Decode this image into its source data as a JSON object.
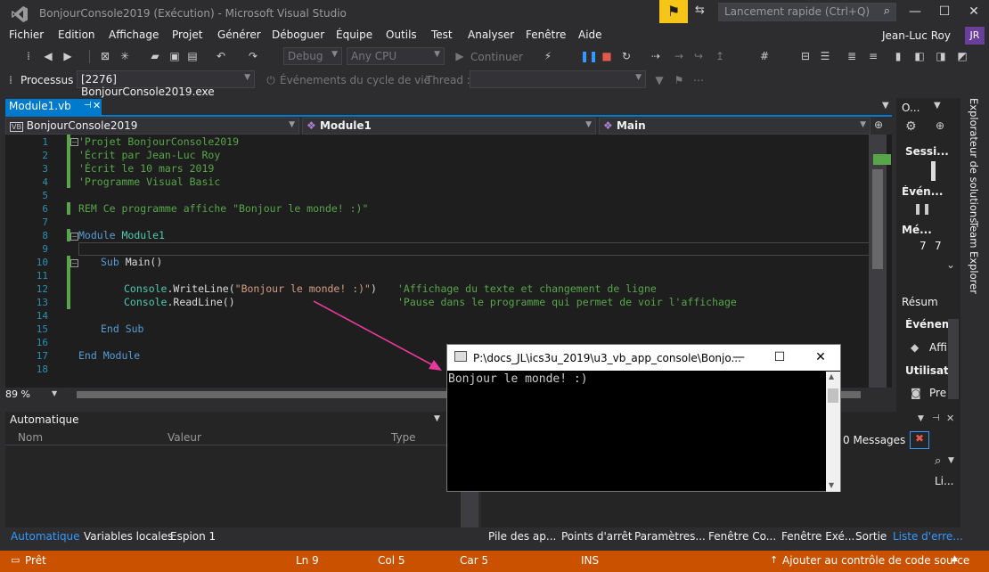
{
  "window": {
    "title": "BonjourConsole2019 (Exécution) - Microsoft Visual Studio",
    "quick_launch_placeholder": "Lancement rapide (Ctrl+Q)",
    "user": "Jean-Luc Roy",
    "user_initials": "JR"
  },
  "menu": [
    "Fichier",
    "Edition",
    "Affichage",
    "Projet",
    "Générer",
    "Déboguer",
    "Équipe",
    "Outils",
    "Test",
    "Analyser",
    "Fenêtre",
    "Aide"
  ],
  "toolbar": {
    "config": "Debug",
    "platform": "Any CPU",
    "continue": "Continuer"
  },
  "debug_toolbar": {
    "process_label": "Processus :",
    "process_value": "[2276] BonjourConsole2019.exe",
    "lifecycle": "Événements du cycle de vie",
    "thread": "Thread :"
  },
  "editor": {
    "tab": "Module1.vb",
    "nav_project": "BonjourConsole2019",
    "nav_module": "Module1",
    "nav_member": "Main",
    "zoom": "89 %",
    "lines": [
      "1",
      "2",
      "3",
      "4",
      "5",
      "6",
      "7",
      "8",
      "9",
      "10",
      "11",
      "12",
      "13",
      "14",
      "15",
      "16",
      "17",
      "18"
    ],
    "code": {
      "l1": "'Projet BonjourConsole2019",
      "l2": "'Écrit par Jean-Luc Roy",
      "l3": "'Écrit le 10 mars 2019",
      "l4": "'Programme Visual Basic",
      "l6": "REM Ce programme affiche \"Bonjour le monde! :)\"",
      "l8_kw": "Module",
      "l8_name": "Module1",
      "l10_kw": "Sub",
      "l10_name": "Main()",
      "l12_type": "Console",
      "l12_call": ".WriteLine(",
      "l12_str": "\"Bonjour le monde! :)\"",
      "l12_close": ")",
      "l12_comment": "'Affichage du texte et changement de ligne",
      "l13_type": "Console",
      "l13_call": ".ReadLine()",
      "l13_comment": "'Pause dans le programme qui permet de voir l'affichage",
      "l15": "End Sub",
      "l17": "End Module"
    }
  },
  "right_panel": {
    "title": "O...",
    "session": "Sessi...",
    "events": "Évén...",
    "methods": "Mé...",
    "sev1": "7",
    "sev2": "7",
    "summary": "Résum",
    "events2": "Événem",
    "affi": "Affi",
    "usage": "Utilisatio",
    "pre": "Pre",
    "tab_solution": "Explorateur de solutions",
    "tab_team": "Team Explorer"
  },
  "auto_panel": {
    "title": "Automatique",
    "col_name": "Nom",
    "col_value": "Valeur",
    "col_type": "Type"
  },
  "error_panel": {
    "messages": "0 Messages",
    "li": "Li..."
  },
  "bottom_tabs_left": [
    "Automatique",
    "Variables locales",
    "Espion 1"
  ],
  "bottom_tabs_right": [
    "Pile des ap...",
    "Points d'arrêt",
    "Paramètres...",
    "Fenêtre Co...",
    "Fenêtre Exé...",
    "Sortie",
    "Liste d'erre..."
  ],
  "console": {
    "title": "P:\\docs_JL\\ics3u_2019\\u3_vb_app_console\\Bonjo...",
    "output": "Bonjour le monde! :)"
  },
  "status": {
    "ready": "Prêt",
    "line": "Ln 9",
    "col": "Col 5",
    "car": "Car 5",
    "mode": "INS",
    "source_control": "Ajouter au contrôle de code source"
  },
  "colors": {
    "accent": "#007acc",
    "status_bar": "#ca5100",
    "arrow": "#e8399b"
  }
}
